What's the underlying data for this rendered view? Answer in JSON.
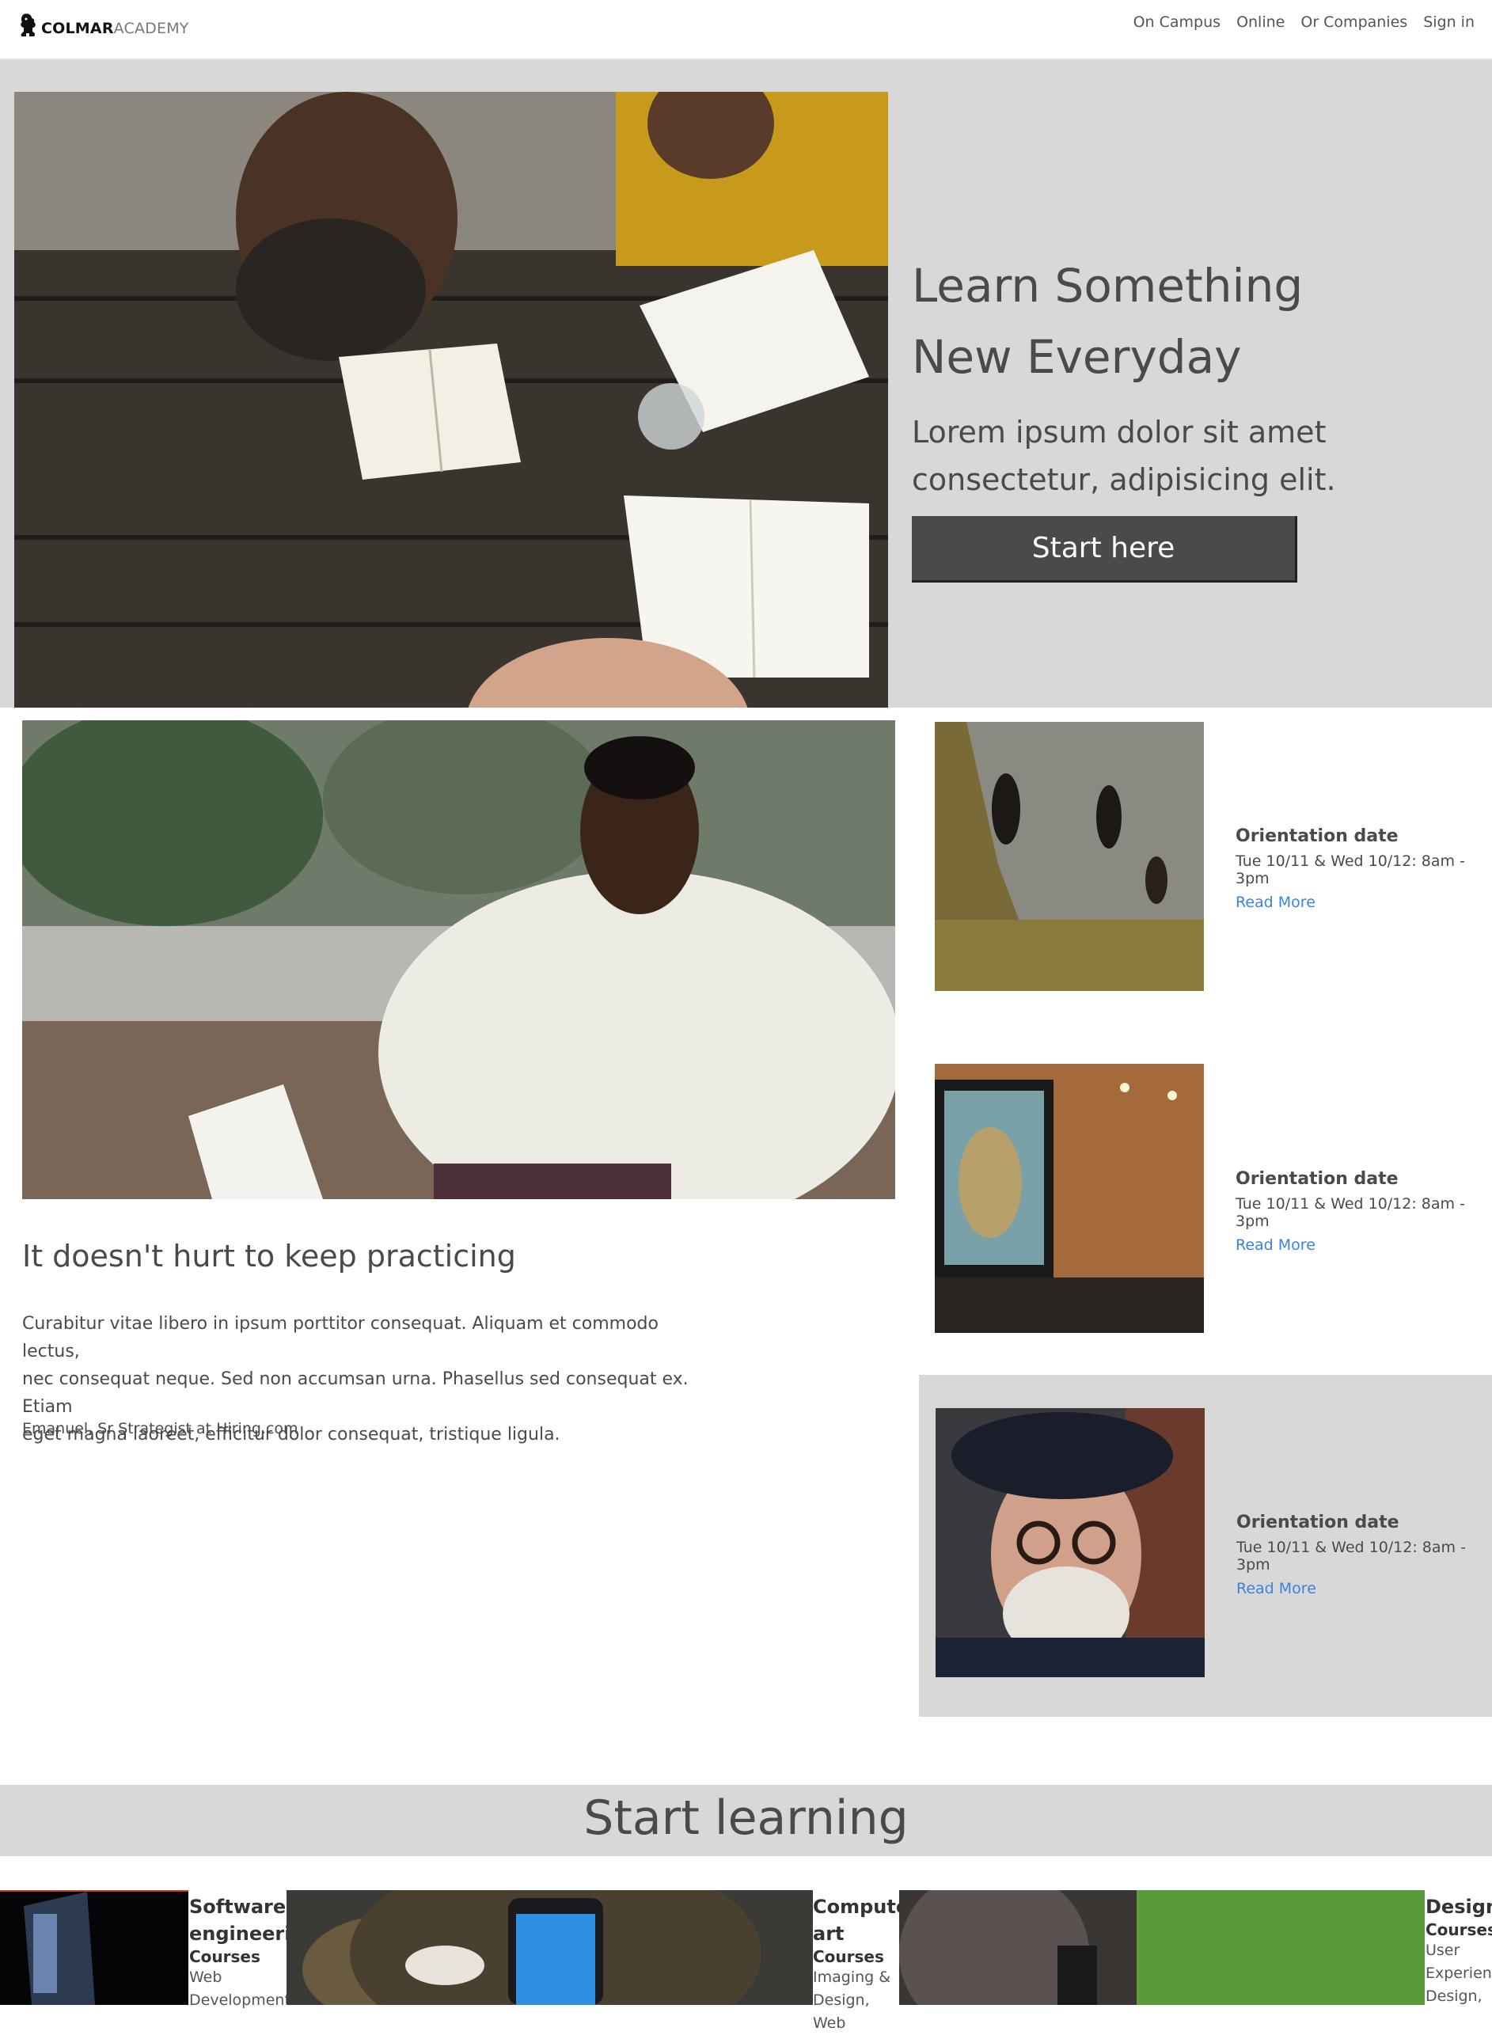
{
  "header": {
    "logo_primary": "COLMAR",
    "logo_secondary": "ACADEMY",
    "nav": [
      "On Campus",
      "Online",
      "Or Companies",
      "Sign in"
    ]
  },
  "hero": {
    "title_line1": "Learn Something",
    "title_line2": "New Everyday",
    "subtitle_line1": "Lorem ipsum dolor sit amet",
    "subtitle_line2": "consectetur, adipisicing elit.",
    "cta": "Start here"
  },
  "feature": {
    "title": "It doesn't hurt to keep practicing",
    "body_line1": "Curabitur vitae libero in ipsum porttitor consequat. Aliquam et commodo lectus,",
    "body_line2": "nec consequat neque. Sed non accumsan urna. Phasellus sed consequat ex. Etiam",
    "body_line3": "eget magna laoreet, efficitur dolor consequat, tristique ligula.",
    "attribution": "Emanuel, Sr Strategist at Hiring.com"
  },
  "events": [
    {
      "title": "Orientation date",
      "date": "Tue 10/11 & Wed 10/12: 8am - 3pm",
      "link": "Read More"
    },
    {
      "title": "Orientation date",
      "date": "Tue 10/11 & Wed 10/12: 8am - 3pm",
      "link": "Read More"
    },
    {
      "title": "Orientation date",
      "date": "Tue 10/11 & Wed 10/12: 8am - 3pm",
      "link": "Read More"
    }
  ],
  "learning": {
    "title": "Start learning",
    "courses": [
      {
        "title_line1": "Software",
        "title_line2": "engineering",
        "label": "Courses",
        "desc_line1": "Web",
        "desc_line2": "Development"
      },
      {
        "title_line1": "Computer",
        "title_line2": "art",
        "label": "Courses",
        "desc_line1": "Imaging &",
        "desc_line2": "Design, Web"
      },
      {
        "title_line1": "Design",
        "title_line2": "",
        "label": "Courses",
        "desc_line1": "User",
        "desc_line2": "Experience",
        "desc_line3": "Design,"
      }
    ]
  },
  "colors": {
    "band_gray": "#d8d8d8",
    "text_dark": "#4a4a4a",
    "cta_bg": "#4a4a4a",
    "link_blue": "#3b82e0"
  }
}
